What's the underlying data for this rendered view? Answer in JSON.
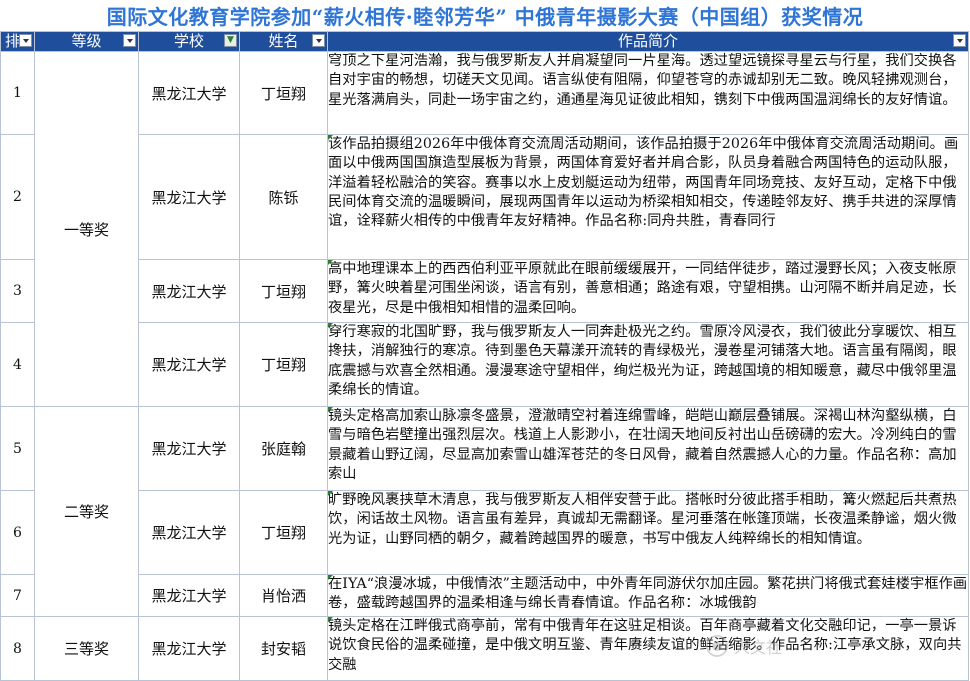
{
  "title": "国际文化教育学院参加“薪火相传·睦邻芳华” 中俄青年摄影大赛（中国组）获奖情况",
  "columns": {
    "rank": "排",
    "level": "等级",
    "school": "学校",
    "name": "姓名",
    "desc": "作品简介"
  },
  "levels": {
    "first": "一等奖",
    "second": "二等奖",
    "third": "三等奖"
  },
  "rows": [
    {
      "num": "1",
      "school": "黑龙江大学",
      "name": "丁垣翔",
      "desc": "穹顶之下星河浩瀚，我与俄罗斯友人并肩凝望同一片星海。透过望远镜探寻星云与行星，我们交换各自对宇宙的畅想，切磋天文见闻。语言纵使有阻隔，仰望苍穹的赤诚却别无二致。晚风轻拂观测台，星光落满肩头，同赴一场宇宙之约，通通星海见证彼此相知，镌刻下中俄两国温润绵长的友好情谊。"
    },
    {
      "num": "2",
      "school": "黑龙江大学",
      "name": "陈铄",
      "desc": "该作品拍摄组2026年中俄体育交流周活动期间，该作品拍摄于2026年中俄体育交流周活动期间。画面以中俄两国国旗造型展板为背景，两国体育爱好者并肩合影，队员身着融合两国特色的运动队服，洋溢着轻松融洽的笑容。赛事以水上皮划艇运动为纽带，两国青年同场竞技、友好互动，定格下中俄民间体育交流的温暖瞬间，展现两国青年以运动为桥梁相知相交，传递睦邻友好、携手共进的深厚情谊，诠释薪火相传的中俄青年友好精神。作品名称:同舟共胜，青春同行"
    },
    {
      "num": "3",
      "school": "黑龙江大学",
      "name": "丁垣翔",
      "desc": "高中地理课本上的西西伯利亚平原就此在眼前缓缓展开，一同结伴徒步，踏过漫野长风；入夜支帐原野，篝火映着星河围坐闲谈，语言有别，善意相通；路途有艰，守望相携。山河隔不断并肩足迹，长夜星光，尽是中俄相知相惜的温柔回响。"
    },
    {
      "num": "4",
      "school": "黑龙江大学",
      "name": "丁垣翔",
      "desc": "穿行寒寂的北国旷野，我与俄罗斯友人一同奔赴极光之约。雪原冷风浸衣，我们彼此分享暖饮、相互搀扶，消解独行的寒凉。待到墨色天幕漾开流转的青绿极光，漫卷星河铺落大地。语言虽有隔阂，眼底震撼与欢喜全然相通。漫漫寒途守望相伴，绚烂极光为证，跨越国境的相知暖意，藏尽中俄邻里温柔绵长的情谊。"
    },
    {
      "num": "5",
      "school": "黑龙江大学",
      "name": "张庭翰",
      "desc": "镜头定格高加索山脉凛冬盛景，澄澈晴空衬着连绵雪峰，皑皑山巅层叠铺展。深褐山林沟壑纵横，白雪与暗色岩壁撞出强烈层次。栈道上人影渺小，在壮阔天地间反衬出山岳磅礴的宏大。冷冽纯白的雪景藏着山野辽阔，尽显高加索雪山雄浑苍茫的冬日风骨，藏着自然震撼人心的力量。作品名称：高加索山"
    },
    {
      "num": "6",
      "school": "黑龙江大学",
      "name": "丁垣翔",
      "desc": "旷野晚风裹挟草木清息，我与俄罗斯友人相伴安营于此。搭帐时分彼此搭手相助，篝火燃起后共煮热饮，闲话故土风物。语言虽有差异，真诚却无需翻译。星河垂落在帐篷顶端，长夜温柔静谧，烟火微光为证，山野同栖的朝夕，藏着跨越国界的暖意，书写中俄友人纯粹绵长的相知情谊。"
    },
    {
      "num": "7",
      "school": "黑龙江大学",
      "name": "肖怡洒",
      "desc": "在IYA“浪漫冰城，中俄情浓”主题活动中，中外青年同游伏尔加庄园。繁花拱门将俄式套娃楼宇框作画卷，盛载跨越国界的温柔相逢与绵长青春情谊。作品名称：冰城俄韵"
    },
    {
      "num": "8",
      "school": "黑龙江大学",
      "name": "封安韬",
      "desc": "镜头定格在江畔俄式商亭前，常有中俄青年在这驻足相谈。百年商亭藏着文化交融印记，一亭一景诉说饮食民俗的温柔碰撞，是中俄文明互鉴、青年赓续友谊的鲜活缩影。作品名称:江亭承文脉，双向共交融"
    }
  ],
  "watermark": "人文社"
}
